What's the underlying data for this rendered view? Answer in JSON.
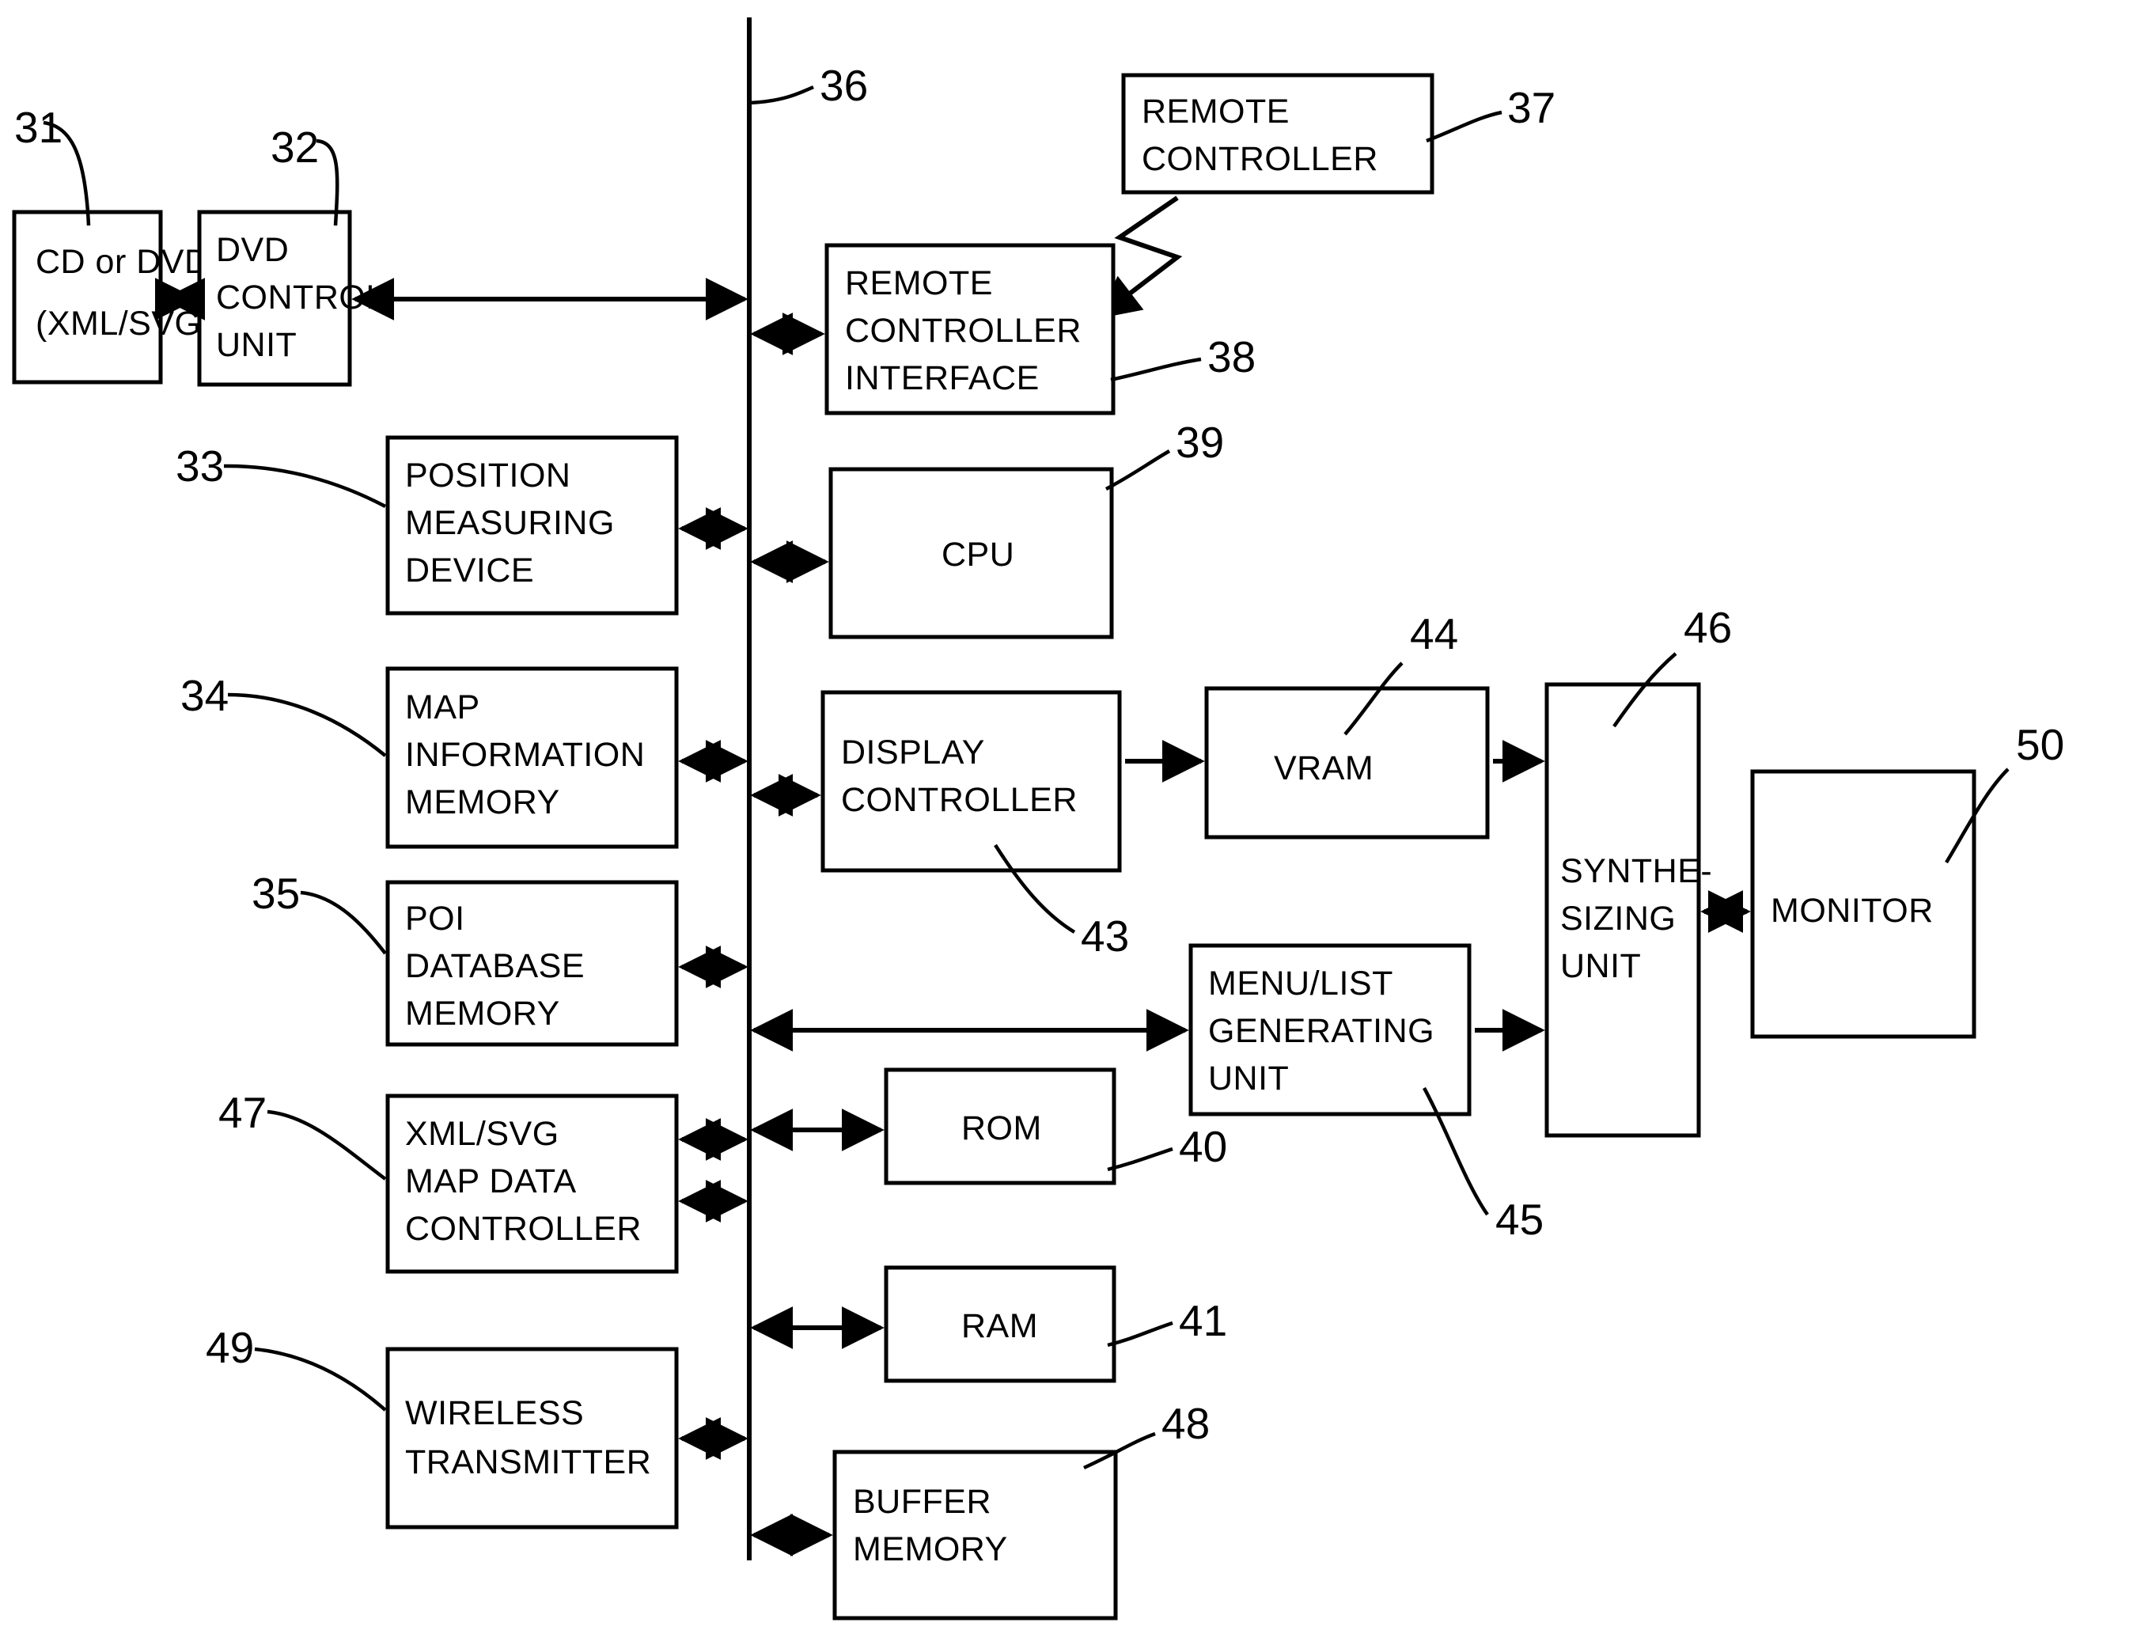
{
  "figure": {
    "type": "patent-block-diagram",
    "background_color": "#ffffff",
    "line_color": "#000000"
  },
  "blocks": [
    {
      "id": "cd-or-dvd",
      "ref": "31",
      "lines": [
        "CD or DVD",
        "(XML/SVG)"
      ]
    },
    {
      "id": "dvd-control-unit",
      "ref": "32",
      "lines": [
        "DVD",
        "CONTROL",
        "UNIT"
      ]
    },
    {
      "id": "position-measuring",
      "ref": "33",
      "lines": [
        "POSITION",
        "MEASURING",
        "DEVICE"
      ]
    },
    {
      "id": "map-information",
      "ref": "34",
      "lines": [
        "MAP",
        "INFORMATION",
        "MEMORY"
      ]
    },
    {
      "id": "poi-database",
      "ref": "35",
      "lines": [
        "POI",
        "DATABASE",
        "MEMORY"
      ]
    },
    {
      "id": "xmlsvg-map-data",
      "ref": "47",
      "lines": [
        "XML/SVG",
        "MAP DATA",
        "CONTROLLER"
      ]
    },
    {
      "id": "wireless-transmitter",
      "ref": "49",
      "lines": [
        "WIRELESS",
        "TRANSMITTER"
      ]
    },
    {
      "id": "remote-controller",
      "ref": "37",
      "lines": [
        "REMOTE",
        "CONTROLLER"
      ]
    },
    {
      "id": "remote-ctrl-interface",
      "ref": "38",
      "lines": [
        "REMOTE",
        "CONTROLLER",
        "INTERFACE"
      ]
    },
    {
      "id": "cpu",
      "ref": "39",
      "lines": [
        "CPU"
      ]
    },
    {
      "id": "display-controller",
      "ref": "43",
      "lines": [
        "DISPLAY",
        "CONTROLLER"
      ]
    },
    {
      "id": "rom",
      "ref": "40",
      "lines": [
        "ROM"
      ]
    },
    {
      "id": "ram",
      "ref": "41",
      "lines": [
        "RAM"
      ]
    },
    {
      "id": "buffer-memory",
      "ref": "48",
      "lines": [
        "BUFFER",
        "MEMORY"
      ]
    },
    {
      "id": "vram",
      "ref": "44",
      "lines": [
        "VRAM"
      ]
    },
    {
      "id": "menu-list-generating",
      "ref": "45",
      "lines": [
        "MENU/LIST",
        "GENERATING",
        "UNIT"
      ]
    },
    {
      "id": "synthesizing-unit",
      "ref": "46",
      "lines": [
        "SYNTHE-",
        "SIZING",
        "UNIT"
      ]
    },
    {
      "id": "monitor",
      "ref": "50",
      "lines": [
        "MONITOR"
      ]
    }
  ],
  "bus": {
    "id": "system-bus",
    "ref": "36"
  },
  "labels": {
    "cd_or_dvd_l1": "CD or DVD",
    "cd_or_dvd_l2": "(XML/SVG)",
    "dvd_control_l1": "DVD",
    "dvd_control_l2": "CONTROL",
    "dvd_control_l3": "UNIT",
    "position_l1": "POSITION",
    "position_l2": "MEASURING",
    "position_l3": "DEVICE",
    "map_info_l1": "MAP",
    "map_info_l2": "INFORMATION",
    "map_info_l3": "MEMORY",
    "poi_l1": "POI",
    "poi_l2": "DATABASE",
    "poi_l3": "MEMORY",
    "xmlsvg_l1": "XML/SVG",
    "xmlsvg_l2": "MAP DATA",
    "xmlsvg_l3": "CONTROLLER",
    "wireless_l1": "WIRELESS",
    "wireless_l2": "TRANSMITTER",
    "remote_ctrl_l1": "REMOTE",
    "remote_ctrl_l2": "CONTROLLER",
    "remote_if_l1": "REMOTE",
    "remote_if_l2": "CONTROLLER",
    "remote_if_l3": "INTERFACE",
    "cpu_l1": "CPU",
    "display_l1": "DISPLAY",
    "display_l2": "CONTROLLER",
    "rom_l1": "ROM",
    "ram_l1": "RAM",
    "buffer_l1": "BUFFER",
    "buffer_l2": "MEMORY",
    "vram_l1": "VRAM",
    "menu_l1": "MENU/LIST",
    "menu_l2": "GENERATING",
    "menu_l3": "UNIT",
    "synth_l1": "SYNTHE-",
    "synth_l2": "SIZING",
    "synth_l3": "UNIT",
    "monitor_l1": "MONITOR"
  },
  "refs": {
    "r31": "31",
    "r32": "32",
    "r33": "33",
    "r34": "34",
    "r35": "35",
    "r36": "36",
    "r37": "37",
    "r38": "38",
    "r39": "39",
    "r40": "40",
    "r41": "41",
    "r43": "43",
    "r44": "44",
    "r45": "45",
    "r46": "46",
    "r47": "47",
    "r48": "48",
    "r49": "49",
    "r50": "50"
  }
}
